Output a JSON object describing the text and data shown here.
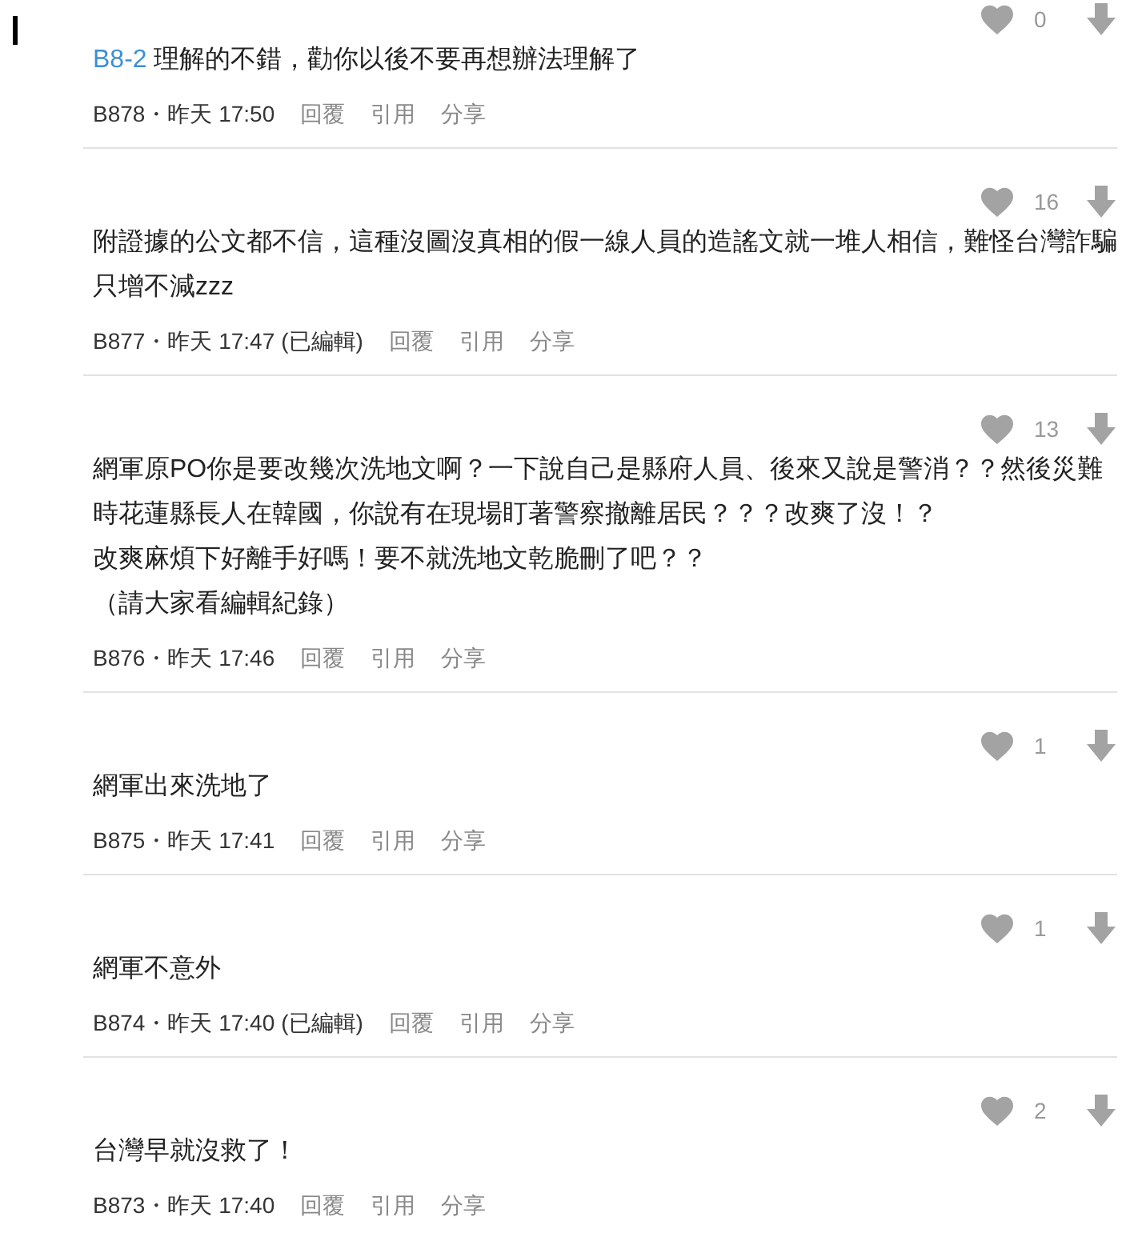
{
  "comments": [
    {
      "likes": "0",
      "reply_to": "B8-2",
      "lines": [
        "理解的不錯，勸你以後不要再想辦法理解了"
      ],
      "meta": "B878・昨天 17:50",
      "actions": [
        "回覆",
        "引用",
        "分享"
      ]
    },
    {
      "likes": "16",
      "lines": [
        "附證據的公文都不信，這種沒圖沒真相的假一線人員的造謠文就一堆人相信，難怪台灣詐騙",
        "只增不減zzz"
      ],
      "meta": "B877・昨天 17:47",
      "edited": "(已編輯)",
      "actions": [
        "回覆",
        "引用",
        "分享"
      ]
    },
    {
      "likes": "13",
      "lines": [
        "網軍原PO你是要改幾次洗地文啊？一下說自己是縣府人員、後來又說是警消？？然後災難",
        "時花蓮縣長人在韓國，你說有在現場盯著警察撤離居民？？？改爽了沒！？",
        "改爽麻煩下好離手好嗎！要不就洗地文乾脆刪了吧？？",
        "（請大家看編輯紀錄）"
      ],
      "meta": "B876・昨天 17:46",
      "actions": [
        "回覆",
        "引用",
        "分享"
      ]
    },
    {
      "likes": "1",
      "lines": [
        "網軍出來洗地了"
      ],
      "meta": "B875・昨天 17:41",
      "actions": [
        "回覆",
        "引用",
        "分享"
      ]
    },
    {
      "likes": "1",
      "lines": [
        "網軍不意外"
      ],
      "meta": "B874・昨天 17:40",
      "edited": "(已編輯)",
      "actions": [
        "回覆",
        "引用",
        "分享"
      ]
    },
    {
      "likes": "2",
      "lines": [
        "台灣早就沒救了！"
      ],
      "meta": "B873・昨天 17:40",
      "actions": [
        "回覆",
        "引用",
        "分享"
      ]
    }
  ]
}
